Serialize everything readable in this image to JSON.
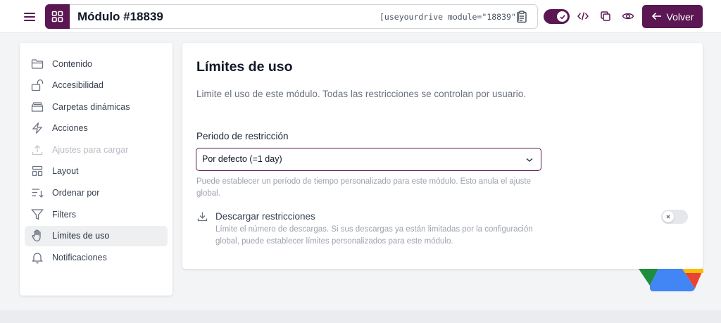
{
  "header": {
    "title": "Módulo #18839",
    "shortcode": "[useyourdrive module=\"18839\"]",
    "back_label": "Volver",
    "accent_color": "#5b1753"
  },
  "sidebar": {
    "items": [
      {
        "label": "Contenido",
        "icon": "folder-icon",
        "state": "normal"
      },
      {
        "label": "Accesibilidad",
        "icon": "unlock-icon",
        "state": "normal"
      },
      {
        "label": "Carpetas dinámicas",
        "icon": "inbox-icon",
        "state": "normal"
      },
      {
        "label": "Acciones",
        "icon": "lightning-icon",
        "state": "normal"
      },
      {
        "label": "Ajustes para cargar",
        "icon": "upload-icon",
        "state": "disabled"
      },
      {
        "label": "Layout",
        "icon": "layout-icon",
        "state": "normal"
      },
      {
        "label": "Ordenar por",
        "icon": "sort-icon",
        "state": "normal"
      },
      {
        "label": "Filters",
        "icon": "filter-icon",
        "state": "normal"
      },
      {
        "label": "Límites de uso",
        "icon": "hand-icon",
        "state": "active"
      },
      {
        "label": "Notificaciones",
        "icon": "bell-icon",
        "state": "normal"
      }
    ]
  },
  "main": {
    "title": "Límites de uso",
    "description": "Limite el uso de este módulo. Todas las restricciones se controlan por usuario.",
    "period": {
      "label": "Periodo de restricción",
      "selected": "Por defecto (=1 day)",
      "help": "Puede establecer un período de tiempo personalizado para este módulo. Esto anula el ajuste global."
    },
    "downloads": {
      "title": "Descargar restricciones",
      "description": "Límite el número de descargas. Si sus descargas ya están limitadas por la configuración global, puede establecer límites personalizados para este módulo.",
      "enabled": false
    }
  }
}
